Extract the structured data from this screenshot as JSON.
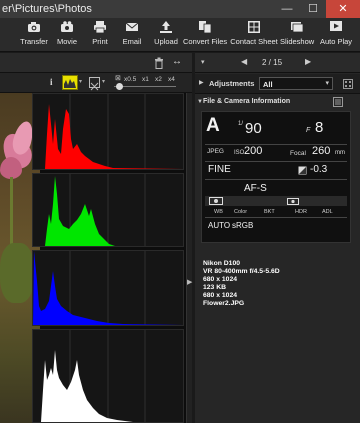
{
  "titlebar": {
    "title": "er\\Pictures\\Photos"
  },
  "window_controls": {
    "minimize": "—",
    "maximize": "☐",
    "close": "✕"
  },
  "toolbar": {
    "transfer": "Transfer",
    "movie": "Movie",
    "print": "Print",
    "email": "Email",
    "upload": "Upload",
    "convert_files": "Convert Files",
    "contact_sheet": "Contact Sheet",
    "slideshow": "Slideshow",
    "auto_play": "Auto Play"
  },
  "viewer_bar": {
    "info_glyph": "i",
    "zoom_labels": [
      "x0.5",
      "x1",
      "x2",
      "x4"
    ]
  },
  "right_panel": {
    "page_indicator": "2 / 15",
    "adjustments_label": "Adjustments",
    "adjustments_value": "All",
    "info_section_title": "File & Camera Information",
    "camera": {
      "mode": "A",
      "shutter_prefix": "1/",
      "shutter": "90",
      "aperture_prefix": "F",
      "aperture": "8",
      "format": "JPEG",
      "iso_label": "ISO",
      "iso": "200",
      "focal_label": "Focal",
      "focal": "260",
      "focal_unit": "mm",
      "quality": "FINE",
      "exposure_comp": "-0.3",
      "focus_mode": "AF-S",
      "wb_label": "WB",
      "color_label": "Color",
      "bkt_label": "BKT",
      "hdr_label": "HDR",
      "adl_label": "ADL",
      "wb_value": "AUTO",
      "color_value": "sRGB"
    },
    "metadata": [
      "Nikon D100",
      "VR 80-400mm f/4.5-5.6D",
      "680 x 1024",
      "123 KB",
      "680 x 1024",
      "Flower2.JPG"
    ]
  },
  "histograms": [
    {
      "channel": "red",
      "color": "#ff0000"
    },
    {
      "channel": "green",
      "color": "#00e600"
    },
    {
      "channel": "blue",
      "color": "#0000ff"
    },
    {
      "channel": "luminance",
      "color": "#ffffff"
    }
  ]
}
